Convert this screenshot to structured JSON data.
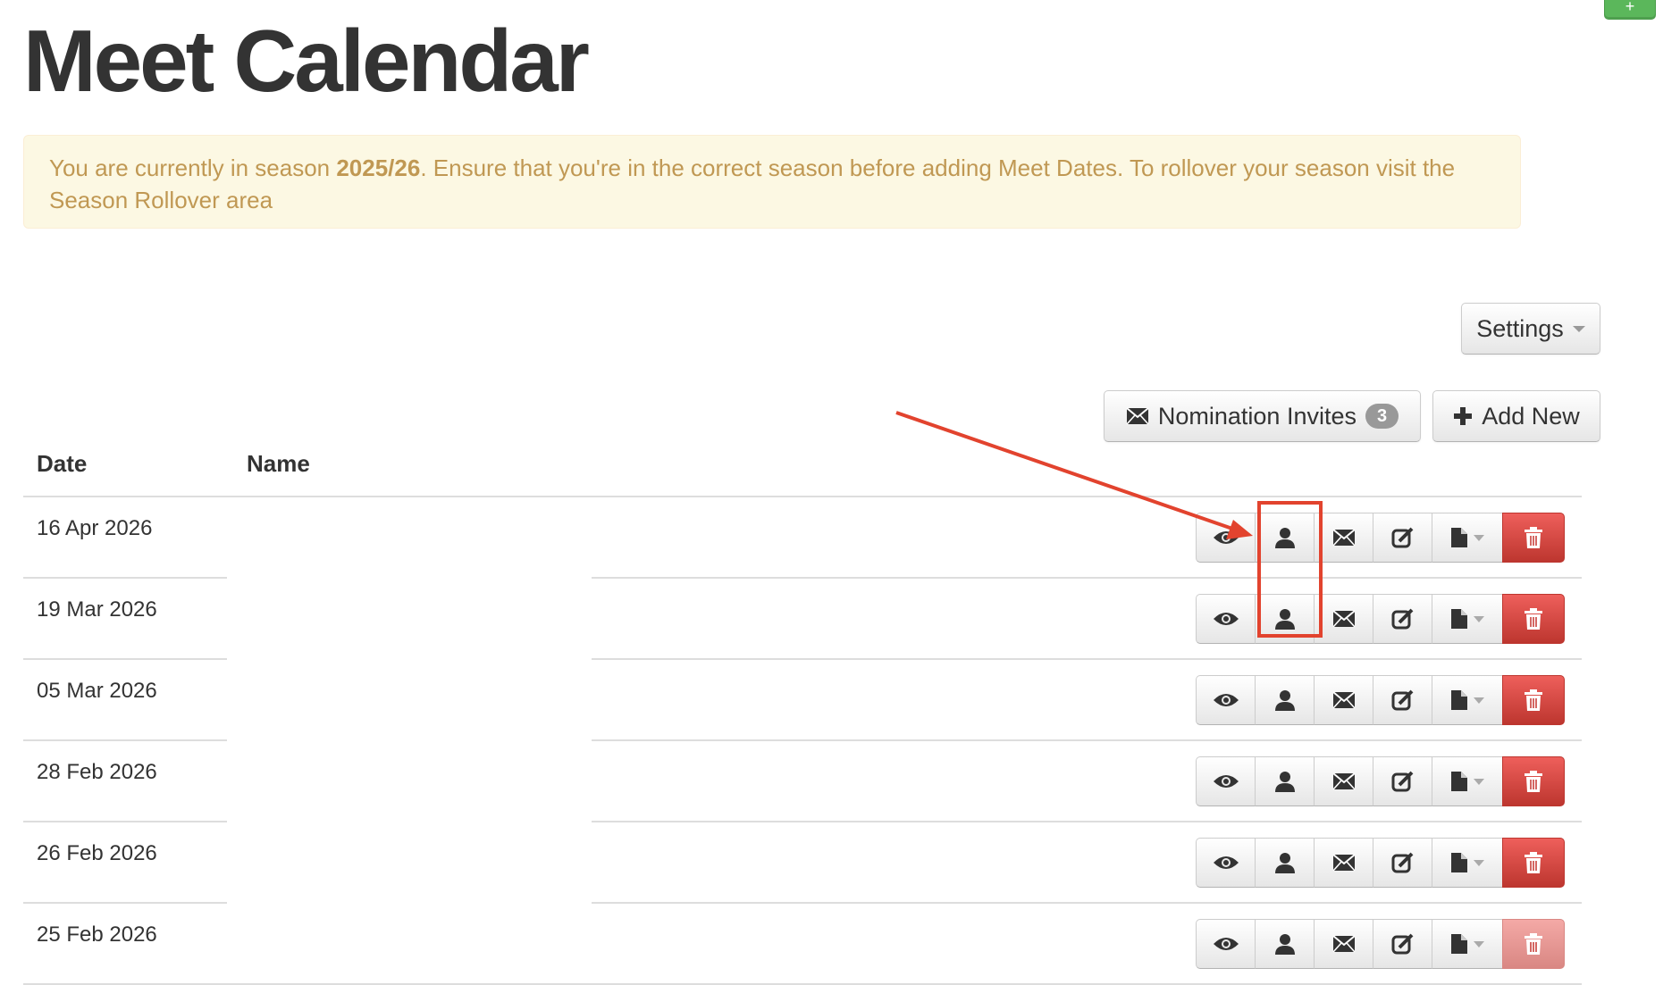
{
  "corner_button": {
    "label": "+"
  },
  "page": {
    "title": "Meet Calendar"
  },
  "alert": {
    "text_before": "You are currently in season ",
    "season": "2025/26",
    "text_after": ". Ensure that you're in the correct season before adding Meet Dates. To rollover your season visit the Season Rollover area"
  },
  "toolbar": {
    "settings_label": "Settings",
    "nomination_invites_label": "Nomination Invites",
    "nomination_invites_count": "3",
    "add_new_label": "Add New"
  },
  "table": {
    "columns": [
      "Date",
      "Name"
    ],
    "rows": [
      {
        "date": "16 Apr 2026",
        "name": ""
      },
      {
        "date": "19 Mar 2026",
        "name": ""
      },
      {
        "date": "05 Mar 2026",
        "name": ""
      },
      {
        "date": "28 Feb 2026",
        "name": ""
      },
      {
        "date": "26 Feb 2026",
        "name": ""
      },
      {
        "date": "25 Feb 2026",
        "name": ""
      }
    ]
  },
  "row_actions": [
    "eye-icon",
    "user-icon",
    "envelope-icon",
    "edit-icon",
    "file-icon",
    "trash-icon"
  ],
  "colors": {
    "danger": "#d9534f",
    "warning_bg": "#fcf8e3",
    "warning_text": "#c09853",
    "annotation": "#e2432e",
    "success": "#5bb75b"
  }
}
